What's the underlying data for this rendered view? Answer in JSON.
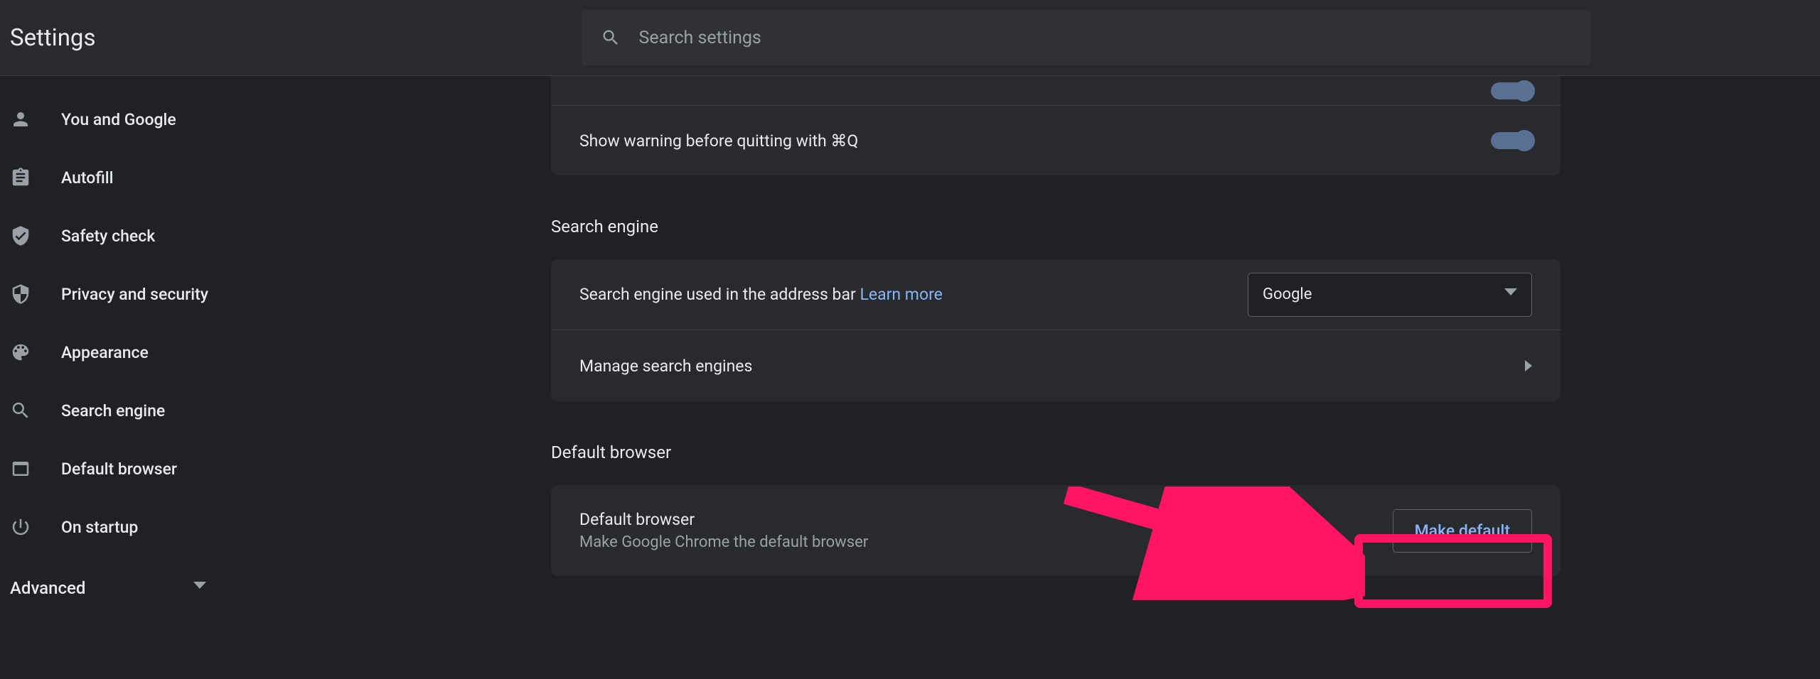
{
  "header": {
    "title": "Settings",
    "search_placeholder": "Search settings"
  },
  "sidebar": {
    "items": [
      {
        "icon": "person",
        "label": "You and Google"
      },
      {
        "icon": "clipboard",
        "label": "Autofill"
      },
      {
        "icon": "shield-check",
        "label": "Safety check"
      },
      {
        "icon": "shield",
        "label": "Privacy and security"
      },
      {
        "icon": "palette",
        "label": "Appearance"
      },
      {
        "icon": "search",
        "label": "Search engine"
      },
      {
        "icon": "window",
        "label": "Default browser"
      },
      {
        "icon": "power",
        "label": "On startup"
      }
    ],
    "advanced_label": "Advanced"
  },
  "content": {
    "warning_row": "Show warning before quitting with ⌘Q",
    "search_engine_section": "Search engine",
    "search_engine_row": "Search engine used in the address bar",
    "learn_more": "Learn more",
    "search_engine_selected": "Google",
    "manage_search": "Manage search engines",
    "default_browser_section": "Default browser",
    "default_browser_title": "Default browser",
    "default_browser_sub": "Make Google Chrome the default browser",
    "make_default_button": "Make default"
  }
}
